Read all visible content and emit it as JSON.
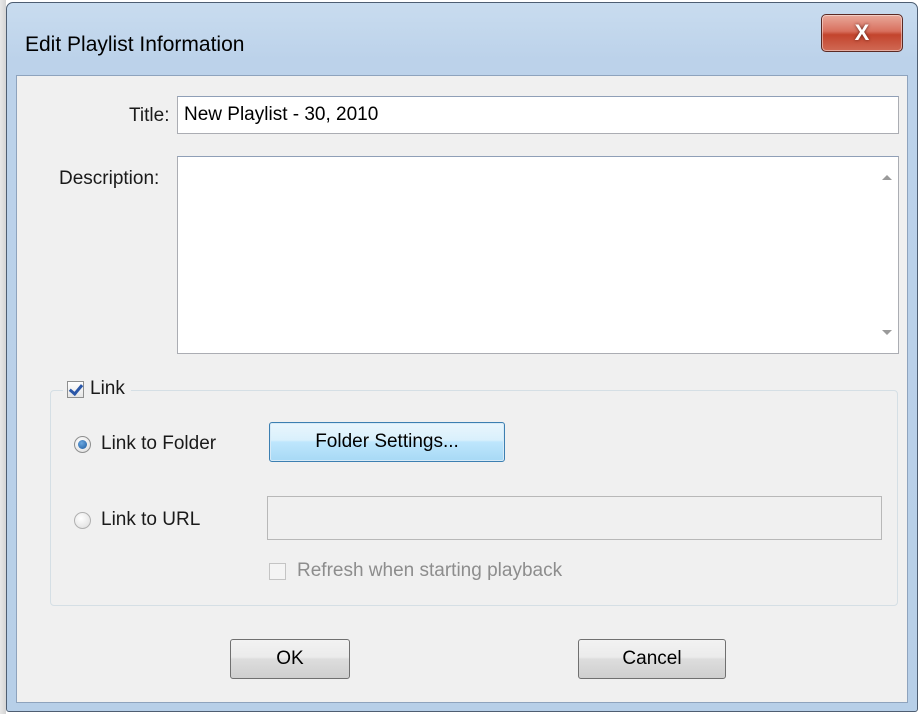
{
  "window": {
    "title": "Edit Playlist Information",
    "close_glyph": "X"
  },
  "form": {
    "title_label": "Title:",
    "title_value": "New Playlist - 30, 2010",
    "description_label": "Description:",
    "description_value": ""
  },
  "link_group": {
    "checkbox_label": "Link",
    "checked": true,
    "link_folder_label": "Link to Folder",
    "link_folder_selected": true,
    "folder_settings_button": "Folder Settings...",
    "link_url_label": "Link to URL",
    "link_url_selected": false,
    "url_value": "",
    "refresh_label": "Refresh when starting playback",
    "refresh_checked": false
  },
  "buttons": {
    "ok": "OK",
    "cancel": "Cancel"
  },
  "colors": {
    "client_bg": "#f0f0f0",
    "frame": "#b7cfe8",
    "close_red": "#c3442d",
    "focus_blue": "#3c7fb1"
  }
}
